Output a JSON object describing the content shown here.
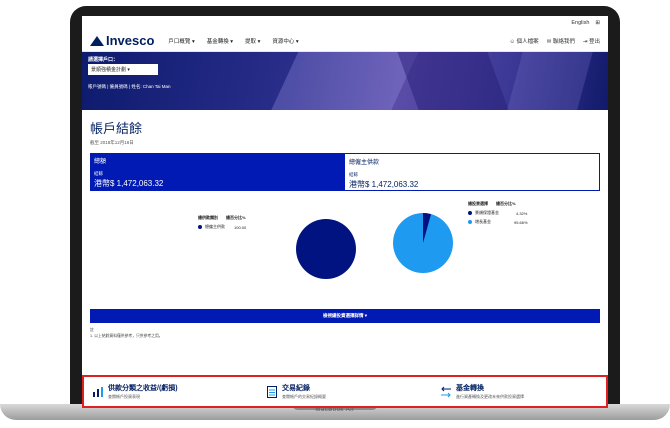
{
  "utility": {
    "language": "English",
    "grid_icon": "grid-icon"
  },
  "nav": {
    "logo_text": "Invesco",
    "menu": [
      "戶口概覽",
      "基金轉換",
      "提取",
      "資源中心"
    ],
    "right": [
      "個人檔案",
      "聯絡我們",
      "登出"
    ]
  },
  "hero": {
    "label": "請選擇戶口：",
    "select_value": "景順強積金計劃",
    "meta": "帳戶號碼 | 僱員號碼 | 姓名: Chan Tai Man"
  },
  "page": {
    "title": "帳戶結餘",
    "as_of": "截至 2018年12月18日"
  },
  "summary": {
    "left": {
      "head": "總額",
      "sub": "結餘",
      "value": "港幣$ 1,472,063.32"
    },
    "right": {
      "head": "總僱主供款",
      "sub": "結餘",
      "value": "港幣$ 1,472,063.32"
    }
  },
  "chart_left_legend": {
    "headers": [
      "總供款類別",
      "總百分比%"
    ],
    "rows": [
      {
        "label": "總僱主供款",
        "value": "100.00",
        "color": "#001380"
      }
    ]
  },
  "chart_right_legend": {
    "headers": [
      "總投資選擇",
      "總百分比%"
    ],
    "rows": [
      {
        "label": "景順保證基金",
        "value": "4.32%",
        "color": "#001380"
      },
      {
        "label": "增長基金",
        "value": "95.66%",
        "color": "#1e9bf0"
      }
    ]
  },
  "chart_data": [
    {
      "type": "pie",
      "labels": [
        "總僱主供款"
      ],
      "values": [
        100.0
      ],
      "colors": [
        "#001380"
      ]
    },
    {
      "type": "pie",
      "labels": [
        "景順保證基金",
        "增長基金"
      ],
      "values": [
        4.32,
        95.66
      ],
      "colors": [
        "#001380",
        "#1e9bf0"
      ]
    }
  ],
  "alloc_button": "檢視總投資選擇詳情",
  "notes": {
    "label": "註",
    "line1": "1. 以上結餘資料僅供參考，只供參考之用。"
  },
  "quick_links": [
    {
      "title": "供款分類之收益/(虧損)",
      "sub": "查閱帳戶投資表現"
    },
    {
      "title": "交易紀錄",
      "sub": "查閱帳戶的交易紀錄概要"
    },
    {
      "title": "基金轉換",
      "sub": "進行資產轉換及更改未來供款投資選擇"
    }
  ],
  "device_label": "MacBook Air"
}
